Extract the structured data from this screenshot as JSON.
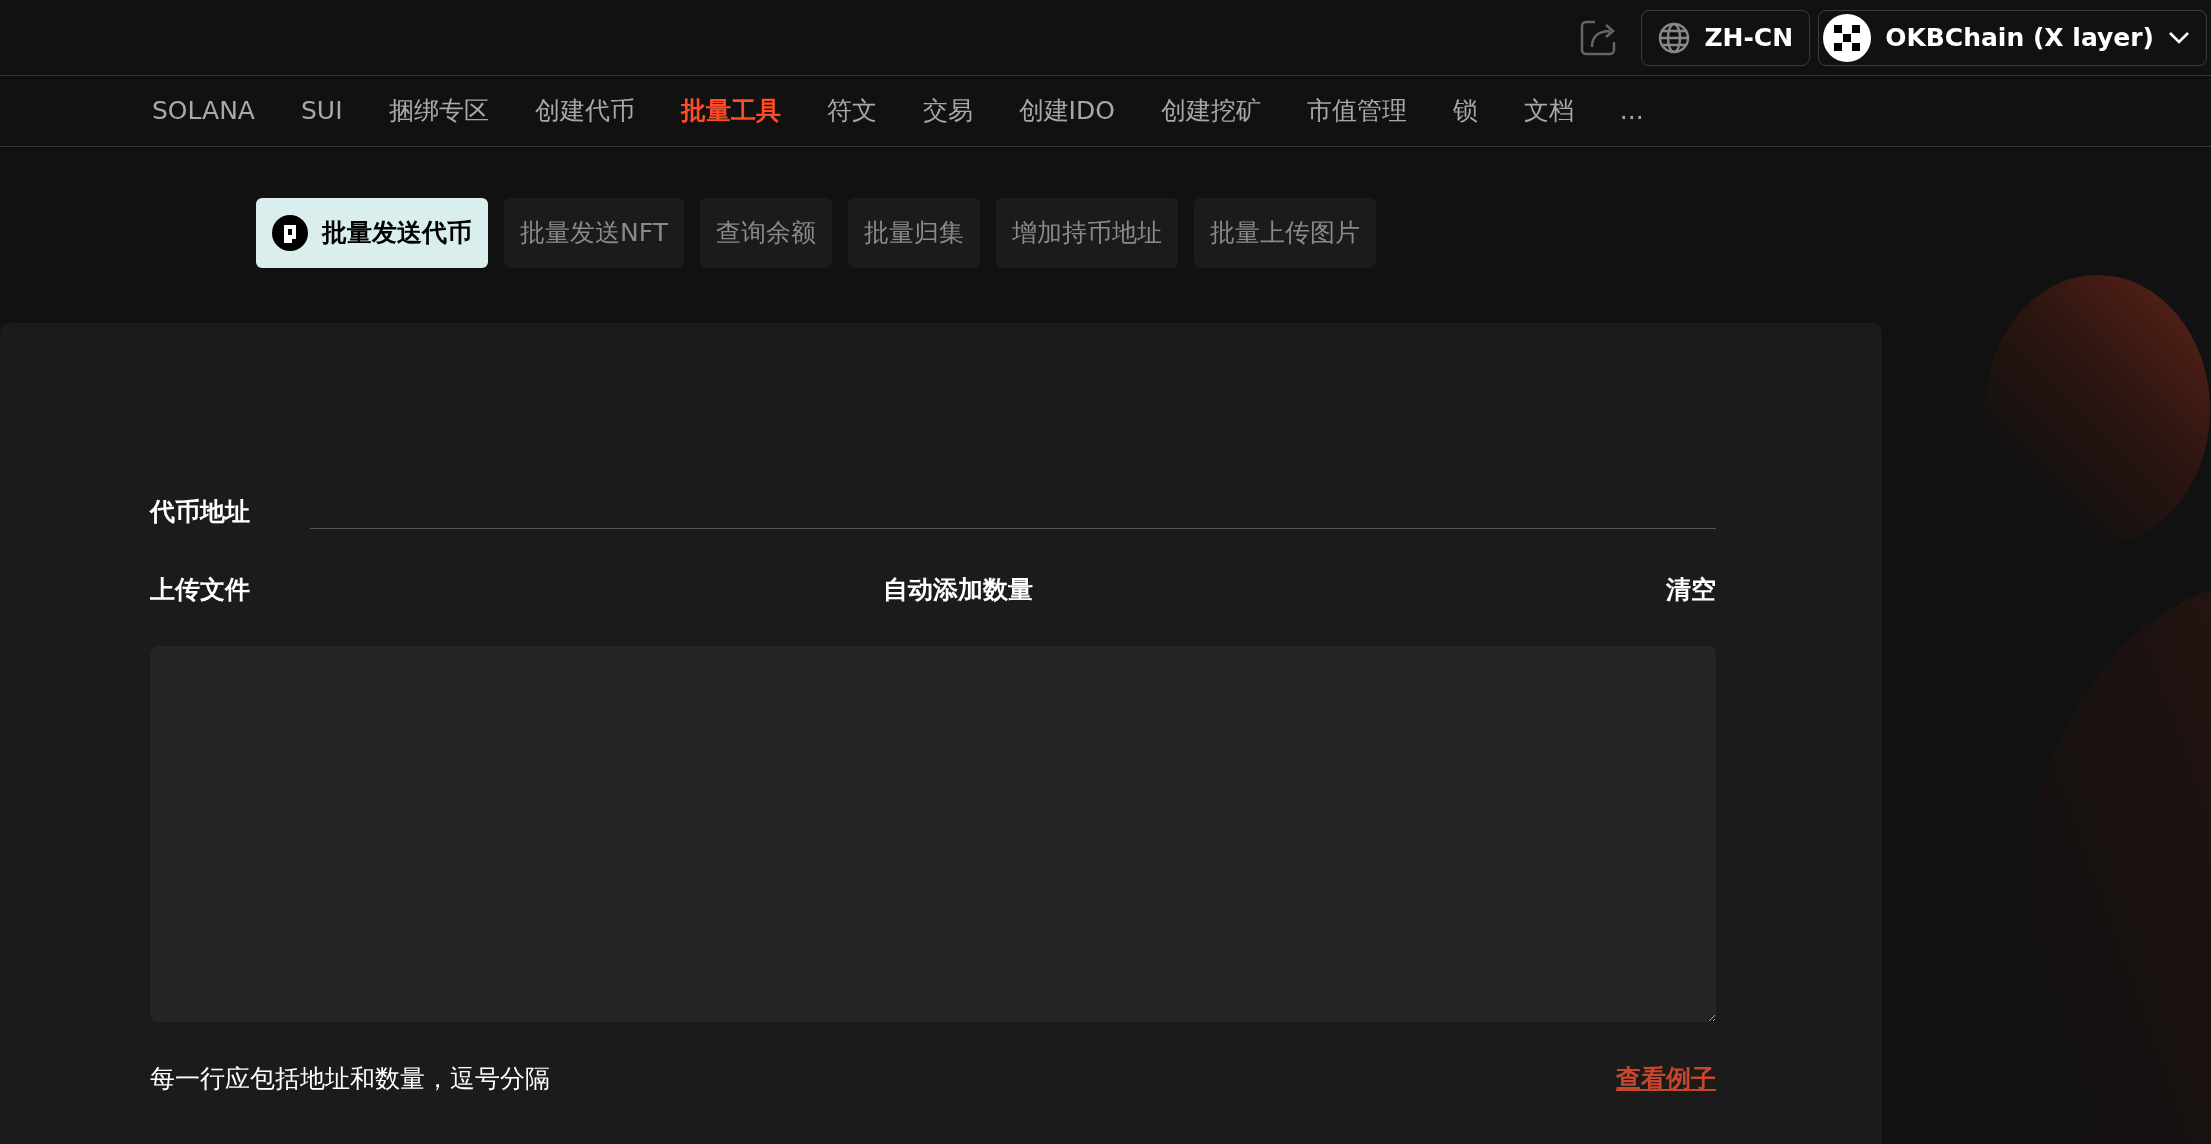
{
  "header": {
    "language": "ZH-CN",
    "network": "OKBChain (X layer)"
  },
  "nav": [
    {
      "label": "SOLANA",
      "selected": false
    },
    {
      "label": "SUI",
      "selected": false
    },
    {
      "label": "捆绑专区",
      "selected": false
    },
    {
      "label": "创建代币",
      "selected": false
    },
    {
      "label": "批量工具",
      "selected": true
    },
    {
      "label": "符文",
      "selected": false
    },
    {
      "label": "交易",
      "selected": false
    },
    {
      "label": "创建IDO",
      "selected": false
    },
    {
      "label": "创建挖矿",
      "selected": false
    },
    {
      "label": "市值管理",
      "selected": false
    },
    {
      "label": "锁",
      "selected": false
    },
    {
      "label": "文档",
      "selected": false
    },
    {
      "label": "...",
      "selected": false
    }
  ],
  "tabs": [
    {
      "label": "批量发送代币",
      "selected": true
    },
    {
      "label": "批量发送NFT",
      "selected": false
    },
    {
      "label": "查询余额",
      "selected": false
    },
    {
      "label": "批量归集",
      "selected": false
    },
    {
      "label": "增加持币地址",
      "selected": false
    },
    {
      "label": "批量上传图片",
      "selected": false
    }
  ],
  "form": {
    "token_address_label": "代币地址",
    "upload_label": "上传文件",
    "auto_add_label": "自动添加数量",
    "clear_label": "清空",
    "hint": "每一行应包括地址和数量，逗号分隔",
    "example_link": "查看例子"
  }
}
